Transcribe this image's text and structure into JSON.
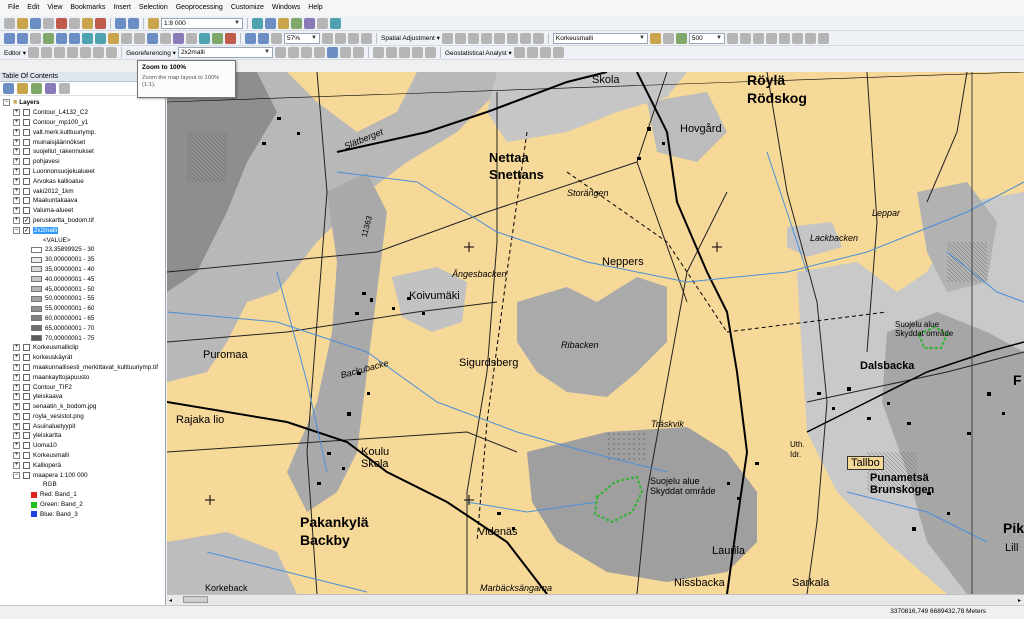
{
  "menu": [
    "File",
    "Edit",
    "View",
    "Bookmarks",
    "Insert",
    "Selection",
    "Geoprocessing",
    "Customize",
    "Windows",
    "Help"
  ],
  "toolbar1": {
    "scale": "1:8 000"
  },
  "toolbar2": {
    "zoom_percent": "57%",
    "spatial_adjustment": "Spatial Adjustment ▾",
    "layer_combo": "Korkeusmalli",
    "cell_size": "500"
  },
  "toolbar3": {
    "editor": "Editor ▾",
    "georeferencing": "Georeferencing ▾",
    "georef_layer": "2x2malli",
    "geostat": "Geostatistical Analyst ▾"
  },
  "tooltip": {
    "title": "Zoom to 100%",
    "desc": "Zoom the map layout to 100% (1:1)."
  },
  "toc": {
    "title": "Table Of Contents",
    "root": "Layers",
    "layers_a": [
      {
        "name": "Contour_L4132_C2",
        "checked": false
      },
      {
        "name": "Contour_mp100_y1",
        "checked": false
      },
      {
        "name": "valt.merk.kulttuuriymp.",
        "checked": false
      },
      {
        "name": "muinaisjäännökset",
        "checked": false
      },
      {
        "name": "suojellut_rakennukset",
        "checked": false
      },
      {
        "name": "pohjavesi",
        "checked": false
      },
      {
        "name": "Luonnonsuojelualueet",
        "checked": false
      },
      {
        "name": "Arvokas kallioalue",
        "checked": false
      },
      {
        "name": "vaki2012_1km",
        "checked": false
      },
      {
        "name": "Maakuntakaava",
        "checked": false
      },
      {
        "name": "Valuma-alueet",
        "checked": false
      },
      {
        "name": "peruskartta_bodom.tif",
        "checked": true
      }
    ],
    "selected_layer": "2x2malli",
    "value_header": "<VALUE>",
    "classes": [
      {
        "label": "23,35899925 - 30",
        "color": "#ffffff"
      },
      {
        "label": "30,00000001 - 35",
        "color": "#ececec"
      },
      {
        "label": "35,00000001 - 40",
        "color": "#dadada"
      },
      {
        "label": "40,00000001 - 45",
        "color": "#c8c8c8"
      },
      {
        "label": "45,00000001 - 50",
        "color": "#b6b6b6"
      },
      {
        "label": "50,00000001 - 55",
        "color": "#a4a4a4"
      },
      {
        "label": "55,00000001 - 60",
        "color": "#929292"
      },
      {
        "label": "60,00000001 - 65",
        "color": "#808080"
      },
      {
        "label": "65,00000001 - 70",
        "color": "#6e6e6e"
      },
      {
        "label": "70,00000001 - 75",
        "color": "#5c5c5c"
      }
    ],
    "layers_b": [
      "Korkeusmalliclip",
      "korkeuskäyrät",
      "maakunnallisesti_merkittavat_kulttuuriymp.tif",
      "maankayttojapuusto",
      "Contour_TIF2",
      "yleiskaava",
      "senaatin_k_bodom.jpg",
      "royla_vesistot.png",
      "Asuinaluetyypit",
      "yleiskartta",
      "Uoma10",
      "Korkeusmalli",
      "Kallioperä",
      "maapera 1:100 000"
    ],
    "rgb_label": "RGB",
    "bands": [
      {
        "label": "Red:   Band_1",
        "color": "#e02020"
      },
      {
        "label": "Green: Band_2",
        "color": "#20c020"
      },
      {
        "label": "Blue:  Band_3",
        "color": "#2040e0"
      }
    ]
  },
  "map_labels": {
    "royla": "Röylä",
    "rodskog": "Rödskog",
    "skola_top": "Skola",
    "hovgard": "Hovgård",
    "nettaa": "Nettaa",
    "snettans": "Snettans",
    "slatberget": "Slätberget",
    "storangen": "Storängen",
    "leppar": "Leppar",
    "lackbacken": "Lackbacken",
    "angesbacken": "Ängesbacken",
    "neppers": "Neppers",
    "koivumaki": "Koivumäki",
    "contour_num": "11363",
    "puromaa": "Puromaa",
    "sigurdsberg": "Sigurdsberg",
    "ribacken": "Ribacken",
    "backubacke": "Backubacke",
    "suojelu1": "Suojelu alue",
    "skyddat1": "Skyddat område",
    "dalsbacka": "Dalsbacka",
    "rajakallio": "Rajaka lio",
    "traskvik": "Träskvik",
    "koulu": "Koulu",
    "skola_mid": "Skola",
    "uth": "Uth.",
    "idr": "Idr.",
    "tallbo": "Tallbo",
    "punametsa": "Punametsä",
    "brunskogen": "Brunskogen",
    "suojelu2": "Suojelu alue",
    "skyddat2": "Skyddat område",
    "pakankyla": "Pakankylä",
    "backby": "Backby",
    "videnas": "Videnäs",
    "laurila": "Laurila",
    "nissbacka": "Nissbacka",
    "sarkala": "Sarkala",
    "korkeback": "Korkeback",
    "marbacks": "Marbäcksängarna",
    "edge_p": "Pik",
    "edge_l": "Lill",
    "edge_f": "F"
  },
  "status": {
    "coords": "3370816,749  6689432,78 Meters"
  }
}
